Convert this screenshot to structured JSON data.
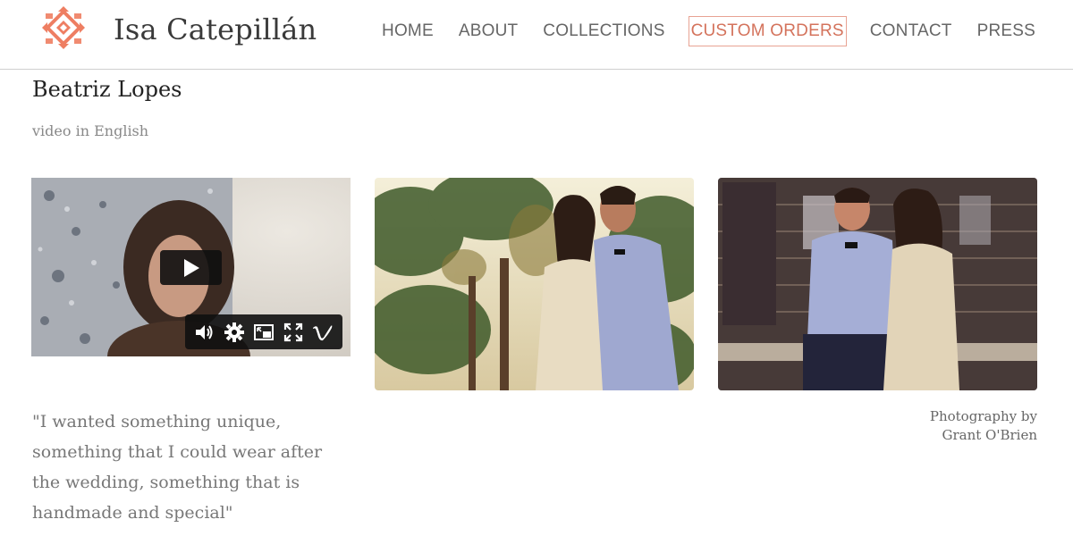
{
  "header": {
    "brand": "Isa Catepillán",
    "nav": [
      {
        "label": "HOME",
        "active": false
      },
      {
        "label": "ABOUT",
        "active": false
      },
      {
        "label": "COLLECTIONS",
        "active": false
      },
      {
        "label": "CUSTOM ORDERS",
        "active": true
      },
      {
        "label": "CONTACT",
        "active": false
      },
      {
        "label": "PRESS",
        "active": false
      }
    ],
    "accent_color": "#d4735c"
  },
  "page": {
    "title": "Beatriz Lopes",
    "subtitle": "video in English"
  },
  "video": {
    "play_icon": "play-icon",
    "controls": [
      "volume-icon",
      "settings-icon",
      "pip-icon",
      "fullscreen-icon",
      "vimeo-icon"
    ]
  },
  "quote": "\"I wanted something unique, something that I could wear after the wedding, something that is handmade and special\"",
  "credit": {
    "line1": "Photography by",
    "line2": "Grant O'Brien"
  }
}
